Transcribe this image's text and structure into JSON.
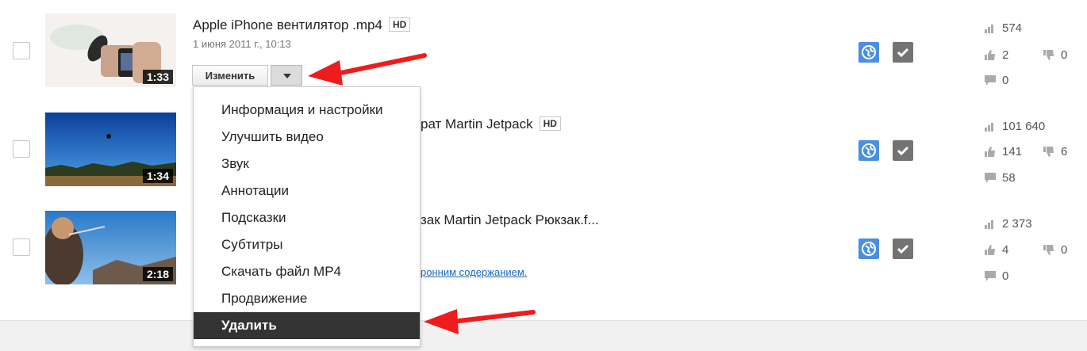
{
  "videos": [
    {
      "title": "Apple iPhone вентилятор .mp4",
      "hd": "HD",
      "date": "1 июня 2011 г., 10:13",
      "duration": "1:33",
      "views": "574",
      "likes": "2",
      "dislikes": "0",
      "comments": "0"
    },
    {
      "title": "рат Martin Jetpack",
      "hd": "HD",
      "duration": "1:34",
      "views": "101 640",
      "likes": "141",
      "dislikes": "6",
      "comments": "58"
    },
    {
      "title": "зак Martin Jetpack Рюкзак.f...",
      "link_text": "ронним содержанием.",
      "duration": "2:18",
      "views": "2 373",
      "likes": "4",
      "dislikes": "0",
      "comments": "0"
    }
  ],
  "edit_button": "Изменить",
  "menu": {
    "items": [
      "Информация и настройки",
      "Улучшить видео",
      "Звук",
      "Аннотации",
      "Подсказки",
      "Субтитры",
      "Скачать файл MP4",
      "Продвижение",
      "Удалить"
    ],
    "active_index": 8
  },
  "icons": {
    "privacy": "globe-icon",
    "status": "checkmark-icon",
    "views": "bar-chart-icon",
    "likes": "thumbs-up-icon",
    "dislikes": "thumbs-down-icon",
    "comments": "comment-icon",
    "dropdown": "caret-down-icon"
  },
  "colors": {
    "annotation_arrow": "#ee1c1c",
    "globe": "#4a8fe0",
    "active_menu": "#333333",
    "link": "#1a67b8"
  }
}
